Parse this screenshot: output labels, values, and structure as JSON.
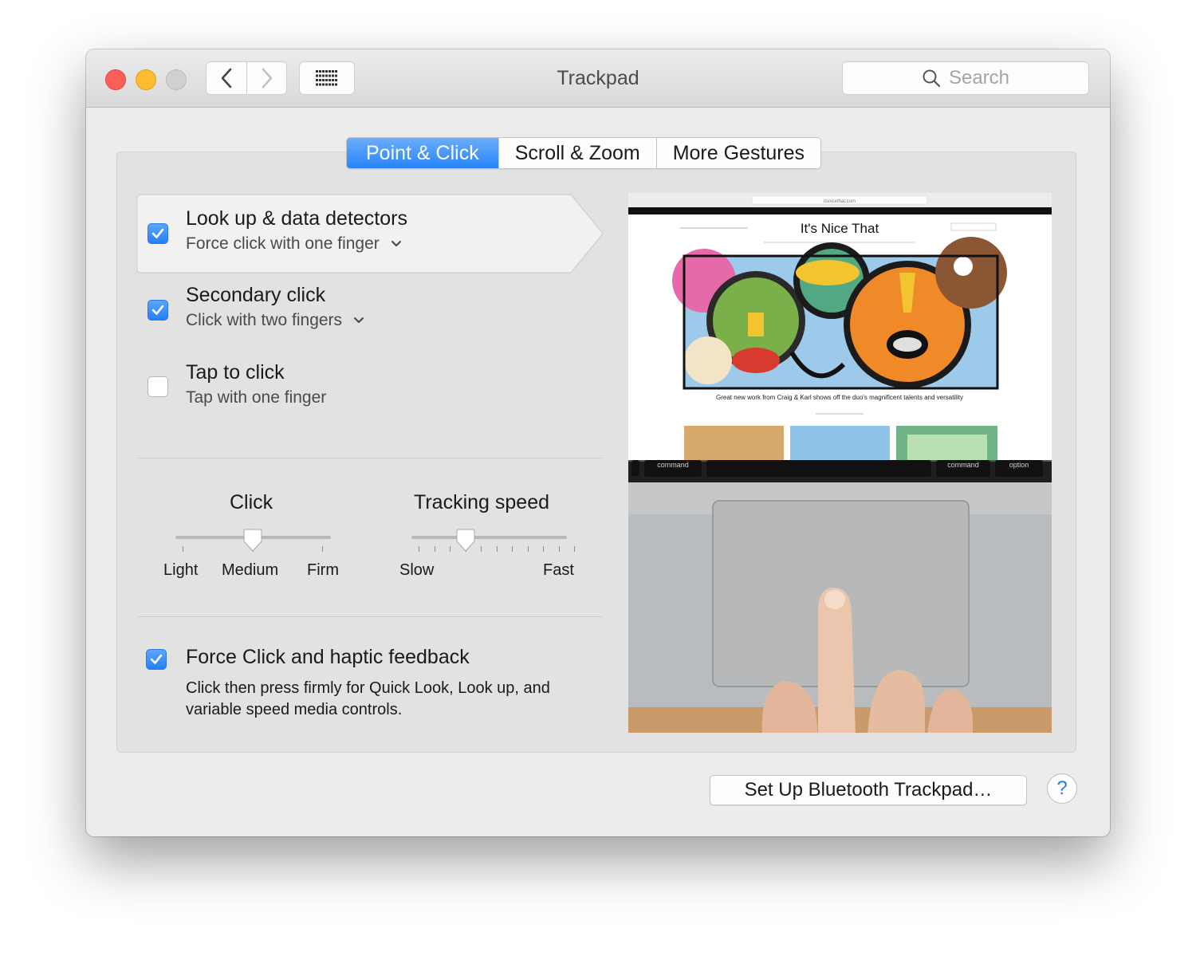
{
  "window": {
    "title": "Trackpad",
    "search": {
      "placeholder": "Search",
      "icon": "magnifier-icon"
    },
    "nav": {
      "back_icon": "chevron-left-icon",
      "forward_icon": "chevron-right-icon",
      "grid_icon": "grid-icon"
    }
  },
  "tabs": [
    {
      "label": "Point & Click",
      "active": true
    },
    {
      "label": "Scroll & Zoom",
      "active": false
    },
    {
      "label": "More Gestures",
      "active": false
    }
  ],
  "options": [
    {
      "title": "Look up & data detectors",
      "subtitle": "Force click with one finger",
      "checked": true,
      "has_menu": true
    },
    {
      "title": "Secondary click",
      "subtitle": "Click with two fingers",
      "checked": true,
      "has_menu": true
    },
    {
      "title": "Tap to click",
      "subtitle": "Tap with one finger",
      "checked": false,
      "has_menu": false
    }
  ],
  "sliders": {
    "click": {
      "title": "Click",
      "labels": [
        "Light",
        "Medium",
        "Firm"
      ],
      "value": "Medium"
    },
    "tracking": {
      "title": "Tracking speed",
      "min_label": "Slow",
      "max_label": "Fast",
      "value_fraction": 0.35
    }
  },
  "force_click": {
    "title": "Force Click and haptic feedback",
    "description": "Click then press firmly for Quick Look, Look up, and variable speed media controls.",
    "checked": true
  },
  "preview": {
    "site_title": "It's Nice That",
    "url": "itsnicethat.com",
    "caption": "Great new work from Craig & Karl shows off the duo's magnificent talents and versatility",
    "keys": [
      "command",
      "command",
      "option"
    ]
  },
  "footer": {
    "bluetooth_button": "Set Up Bluetooth Trackpad…",
    "help": "?"
  },
  "colors": {
    "accent": "#2783f7",
    "close": "#fc5f57",
    "minimize": "#fdbc2e"
  }
}
